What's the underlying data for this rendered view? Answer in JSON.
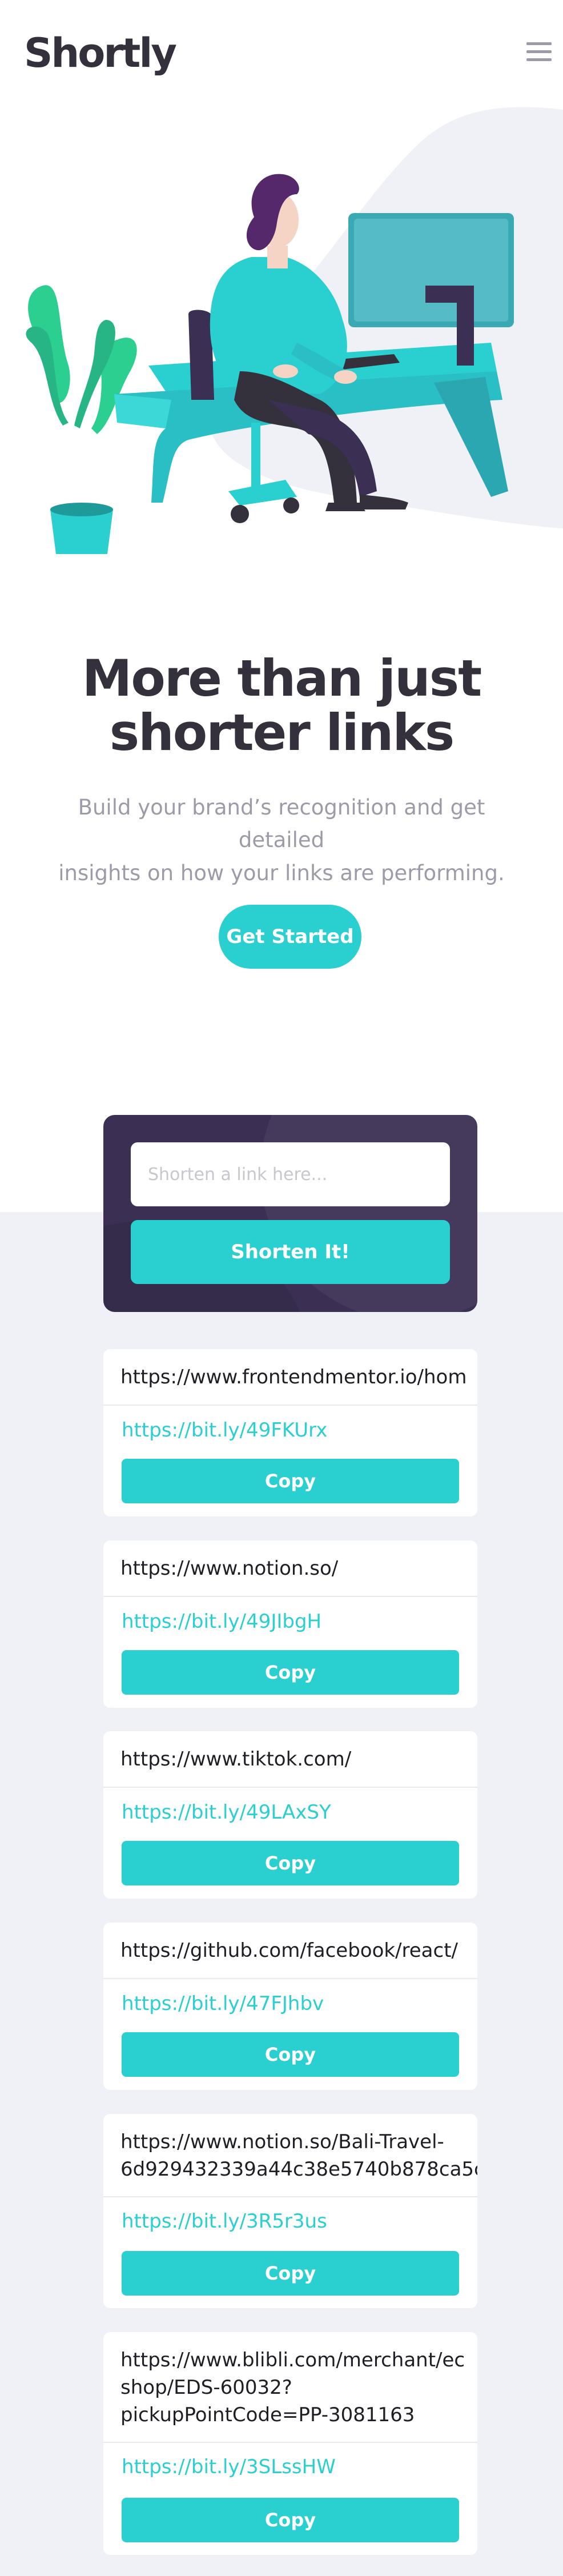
{
  "header": {
    "logo": "Shortly",
    "menu_icon": "hamburger-icon"
  },
  "hero": {
    "illustration": "person-working-illustration",
    "title_line1": "More than just",
    "title_line2": "shorter links",
    "subtitle_line1": "Build your brand’s recognition and get detailed",
    "subtitle_line2": "insights on how your links are performing.",
    "cta_label": "Get Started"
  },
  "shortener": {
    "placeholder": "Shorten a link here...",
    "button_label": "Shorten It!"
  },
  "results": [
    {
      "original": "https://www.frontendmentor.io/hom",
      "short": "https://bit.ly/49FKUrx",
      "copy_label": "Copy"
    },
    {
      "original": "https://www.notion.so/",
      "short": "https://bit.ly/49JIbgH",
      "copy_label": "Copy"
    },
    {
      "original": "https://www.tiktok.com/",
      "short": "https://bit.ly/49LAxSY",
      "copy_label": "Copy"
    },
    {
      "original": "https://github.com/facebook/react/",
      "short": "https://bit.ly/47FJhbv",
      "copy_label": "Copy"
    },
    {
      "original": "https://www.notion.so/Bali-Travel-\n6d929432339a44c38e5740b878ca5c",
      "short": "https://bit.ly/3R5r3us",
      "copy_label": "Copy"
    },
    {
      "original": "https://www.blibli.com/merchant/ec\nshop/EDS-60032?\npickupPointCode=PP-3081163",
      "short": "https://bit.ly/3SLssHW",
      "copy_label": "Copy"
    }
  ],
  "colors": {
    "primary": "#2acfcf",
    "dark_violet": "#3b3054",
    "very_dark_blue": "#34313d",
    "gray": "#9e9aa8",
    "section_bg": "#eff1f7"
  }
}
